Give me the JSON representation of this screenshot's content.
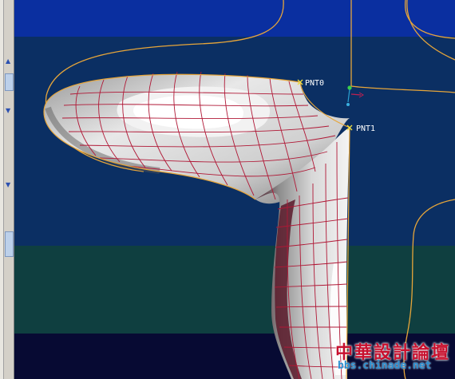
{
  "points": {
    "pnt0_label": "PNT0",
    "pnt1_label": "PNT1"
  },
  "watermark": {
    "chinese": "中華設計論壇",
    "url": "bbs.chinade.net"
  },
  "colors": {
    "background_top": "#0a2fa0",
    "background_upper": "#0b2f63",
    "background_middle": "#0f3f40",
    "background_bottom": "#070a33",
    "curve": "#e6a53a",
    "mesh_lines": "#b01836",
    "datum_point": "#f0e040",
    "surface_highlight": "#ffffff",
    "surface_shadow": "#5a1a2a",
    "watermark_text": "#c8102e",
    "watermark_url": "#2a8fd0"
  },
  "icons": {
    "left_panel": [
      "chevron-up-icon",
      "chevron-down-icon",
      "chevron-down-icon"
    ]
  }
}
